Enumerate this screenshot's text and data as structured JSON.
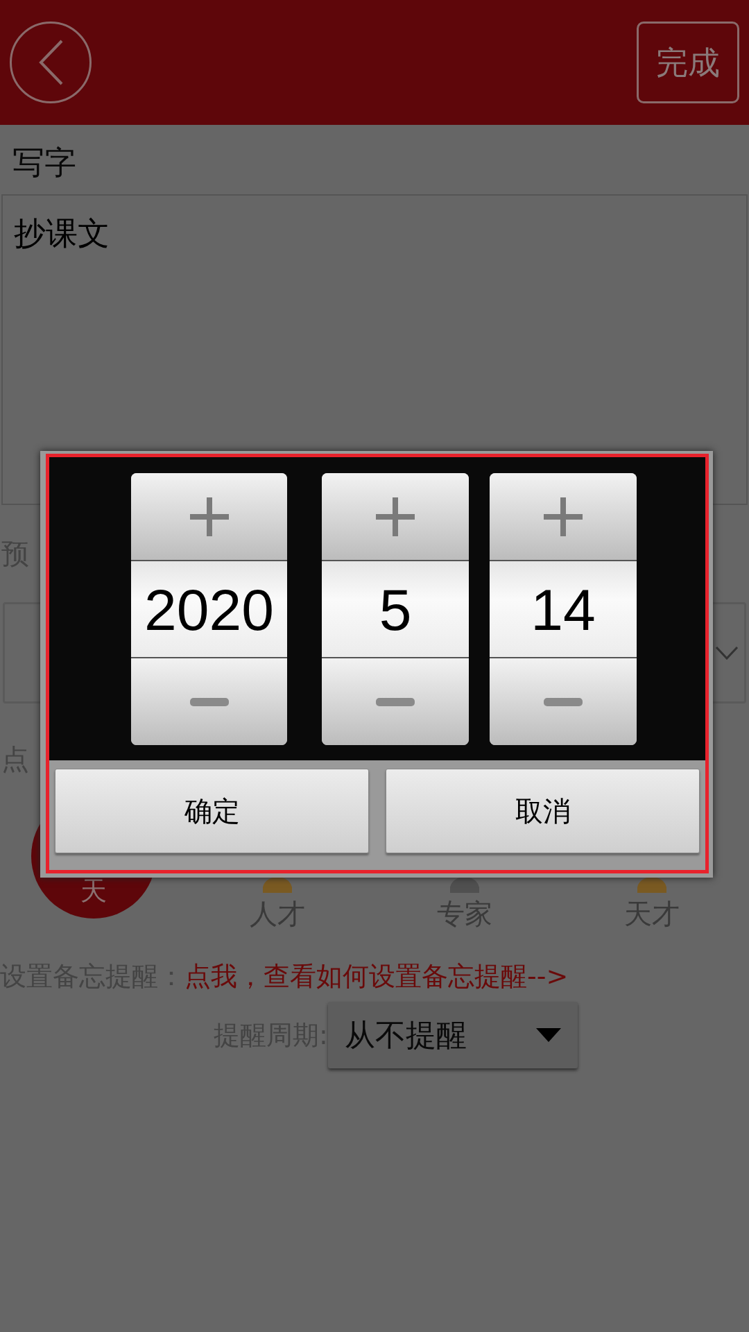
{
  "header": {
    "done_button": "完成"
  },
  "title": "写字",
  "content": {
    "value": "抄课文"
  },
  "due_label": "预",
  "hint": "点",
  "badge": {
    "text": "天"
  },
  "levels": [
    {
      "label": "人才",
      "color": "#7a5a22"
    },
    {
      "label": "专家",
      "color": "#505050"
    },
    {
      "label": "天才",
      "color": "#7a5a22"
    }
  ],
  "reminder": {
    "label": "设置备忘提醒：",
    "link": "点我，查看如何设置备忘提醒-->"
  },
  "cycle": {
    "label": "提醒周期:",
    "value": "从不提醒"
  },
  "date_picker": {
    "columns": [
      {
        "value": "2020"
      },
      {
        "value": "5"
      },
      {
        "value": "14"
      }
    ],
    "buttons": [
      "确定",
      "取消"
    ]
  }
}
